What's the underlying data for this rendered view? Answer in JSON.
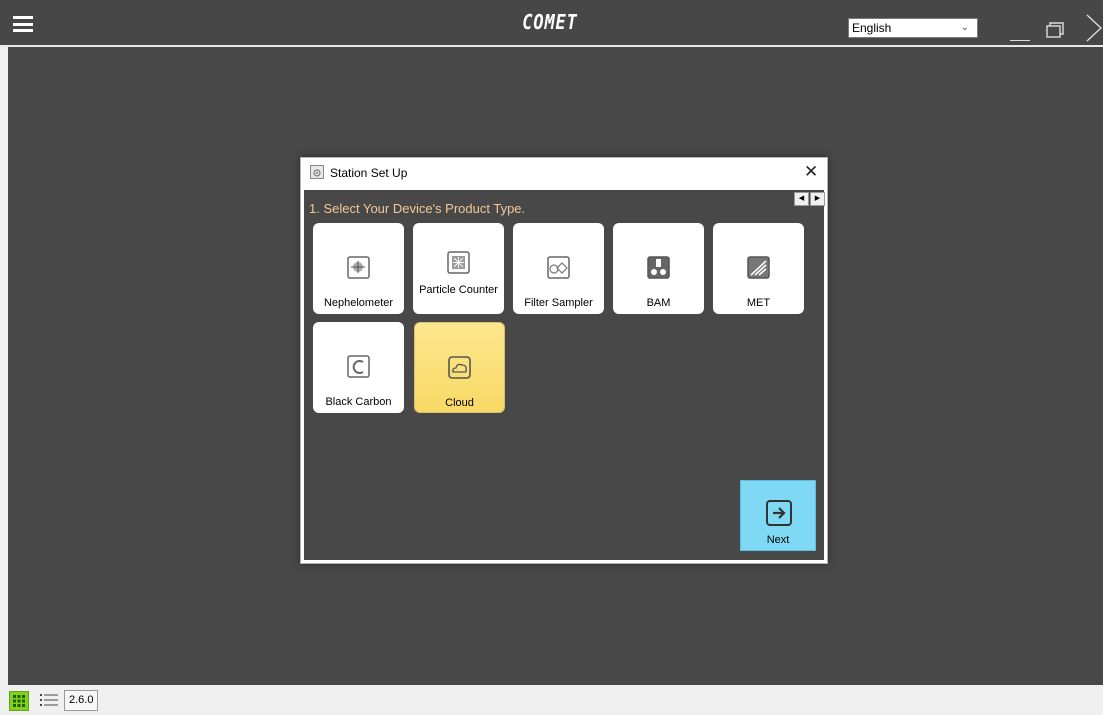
{
  "app": {
    "title": "COMET"
  },
  "header": {
    "language": {
      "selected": "English"
    }
  },
  "dialog": {
    "title": "Station Set Up",
    "step_label": "1. Select Your Device's Product Type.",
    "tiles": [
      {
        "label": "Nephelometer",
        "icon": "nephelometer-icon",
        "selected": false
      },
      {
        "label": "Particle Counter",
        "icon": "particle-counter-icon",
        "selected": false
      },
      {
        "label": "Filter Sampler",
        "icon": "filter-sampler-icon",
        "selected": false
      },
      {
        "label": "BAM",
        "icon": "bam-icon",
        "selected": false
      },
      {
        "label": "MET",
        "icon": "met-icon",
        "selected": false
      },
      {
        "label": "Black Carbon",
        "icon": "black-carbon-icon",
        "selected": false
      },
      {
        "label": "Cloud",
        "icon": "cloud-icon",
        "selected": true
      }
    ],
    "next_label": "Next"
  },
  "footer": {
    "version": "2.6.0"
  },
  "colors": {
    "accent_green": "#7ed321",
    "next_blue": "#7fd9f5",
    "selected_tile": "#f7d965",
    "step_text": "#f2c89a",
    "background_dark": "#484848"
  }
}
